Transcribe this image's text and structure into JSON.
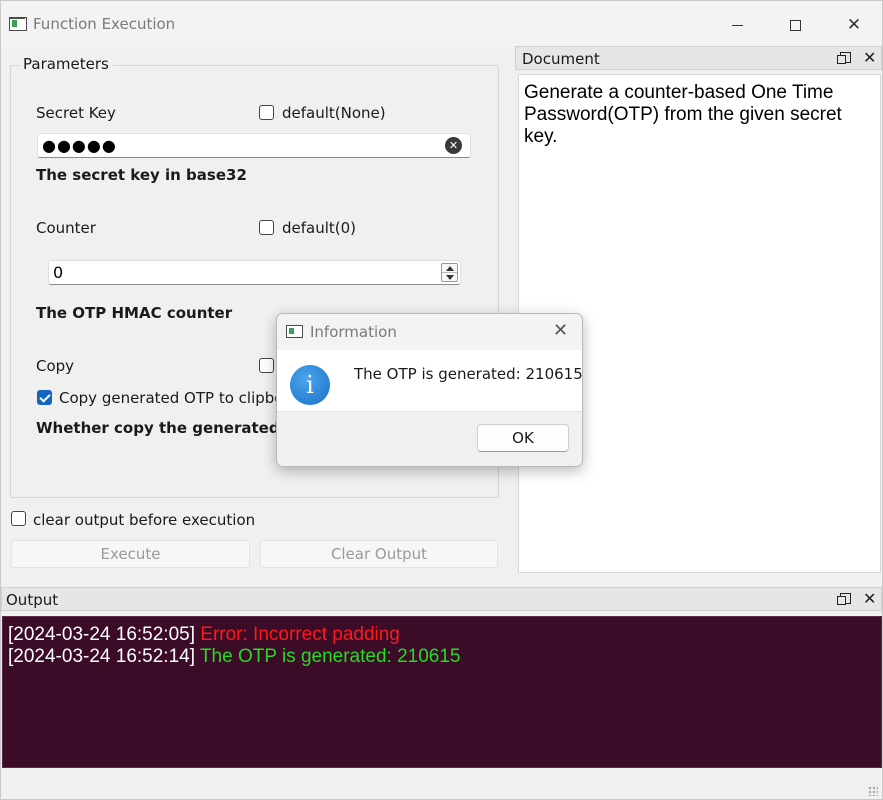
{
  "window": {
    "title": "Function Execution"
  },
  "parameters": {
    "group_title": "Parameters",
    "secret_key": {
      "label": "Secret Key",
      "default_label": "default(None)",
      "default_checked": false,
      "value": "●●●●●",
      "description": "The secret key in base32"
    },
    "counter": {
      "label": "Counter",
      "default_label": "default(0)",
      "default_checked": false,
      "value": "0",
      "description": "The OTP HMAC counter"
    },
    "copy": {
      "label": "Copy",
      "checkbox_label": "Copy generated OTP to clipboard",
      "checkbox_checked": true,
      "description": "Whether copy the generated OTP"
    }
  },
  "clear_output_label": "clear output before execution",
  "clear_output_checked": false,
  "buttons": {
    "execute": "Execute",
    "clear_output": "Clear Output"
  },
  "document": {
    "title": "Document",
    "text": "Generate a counter-based One Time Password(OTP) from the given secret key."
  },
  "output": {
    "title": "Output",
    "lines": [
      {
        "timestamp": "[2024-03-24 16:52:05]",
        "message": "Error: Incorrect padding",
        "kind": "error"
      },
      {
        "timestamp": "[2024-03-24 16:52:14]",
        "message": "The OTP is generated: 210615",
        "kind": "success"
      }
    ]
  },
  "dialog": {
    "title": "Information",
    "message": "The OTP is generated: 210615",
    "ok_label": "OK"
  },
  "colors": {
    "output_bg": "#3b0b28",
    "error": "#ff1a1a",
    "success": "#22dd22",
    "checkbox_accent": "#1565c0",
    "info_icon": "#1a6fc4"
  },
  "icons": {
    "window_close": "✕",
    "dock_close": "✕",
    "dialog_close": "✕",
    "clear_input": "✕",
    "info": "i"
  }
}
